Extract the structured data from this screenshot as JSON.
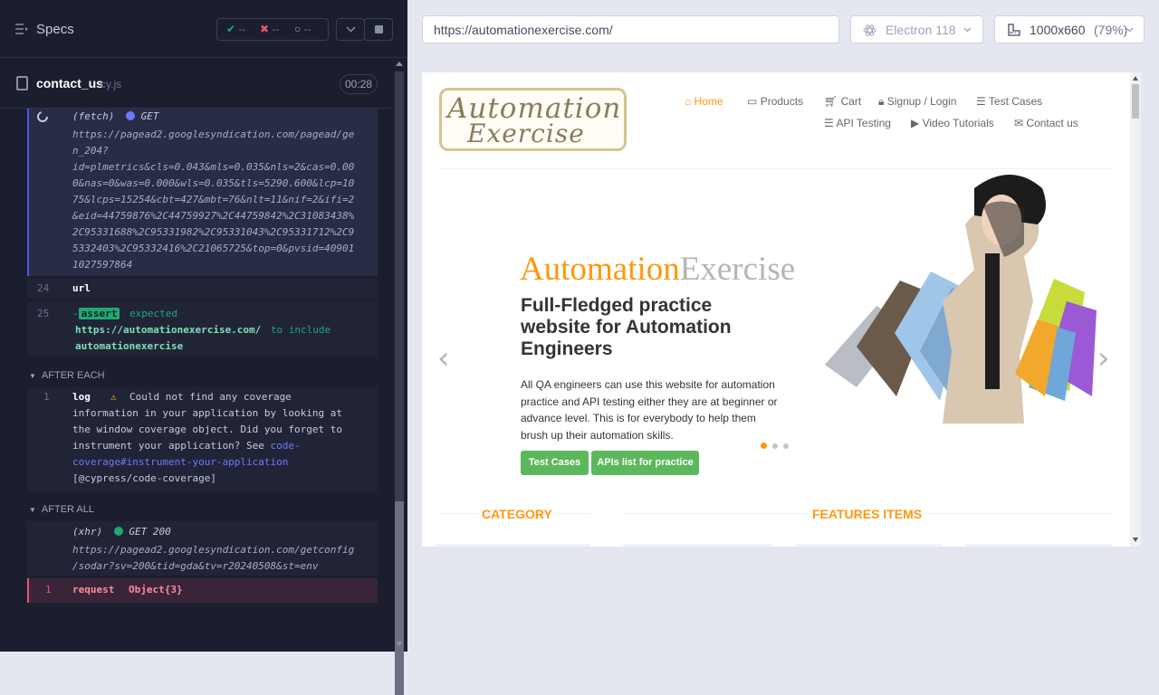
{
  "header": {
    "specs_label": "Specs",
    "pass_count": "--",
    "fail_count": "--",
    "pending_count": "--",
    "spec_file": "contact_us",
    "spec_ext": "cy.js",
    "duration": "00:28"
  },
  "log": {
    "fetch_type": "(fetch)",
    "fetch_method": "GET",
    "fetch_url_lines": [
      "https://pagead2.googlesyndication.com/pagead/ge",
      "n_204?",
      "id=plmetrics&cls=0.043&mls=0.035&nls=2&cas=0.00",
      "0&nas=0&was=0.000&wls=0.035&tls=5290.600&lcp=10",
      "75&lcps=15254&cbt=427&mbt=76&nlt=11&nif=2&ifi=2",
      "&eid=44759876%2C44759927%2C44759842%2C31083438%",
      "2C95331688%2C95331982%2C95331043%2C95331712%2C9",
      "5332403%2C95332416%2C21065725&top=0&pvsid=40901",
      "1027597864"
    ],
    "cmd24_num": "24",
    "cmd24_name": "url",
    "cmd25_num": "25",
    "cmd25_dash": "-",
    "cmd25_badge": "assert",
    "cmd25_expected": "expected",
    "cmd25_value": "https://automationexercise.com/",
    "cmd25_include": "to include",
    "cmd25_target": "automationexercise",
    "after_each_label": "AFTER EACH",
    "ae_num": "1",
    "ae_cmd": "log",
    "ae_msg_lines": [
      "Could not find any coverage",
      "information in your application by looking at",
      "the window coverage object. Did you forget to",
      "instrument your application? See"
    ],
    "ae_link_a": "code-",
    "ae_link_b": "coverage#instrument-your-application",
    "ae_tail": "[@cypress/code-coverage]",
    "after_all_label": "AFTER ALL",
    "xhr_type": "(xhr)",
    "xhr_status": "GET 200",
    "xhr_url_lines": [
      "https://pagead2.googlesyndication.com/getconfig",
      "/sodar?sv=200&tid=gda&tv=r20240508&st=env"
    ],
    "err_num": "1",
    "err_cmd": "request",
    "err_val": "Object{3}"
  },
  "browser": {
    "url": "https://automationexercise.com/",
    "engine": "Electron 118",
    "viewport": "1000x660",
    "zoom": "(79%)"
  },
  "site": {
    "logo_line1": "Automation",
    "logo_line2": "Exercise",
    "nav": {
      "home": "Home",
      "products": "Products",
      "cart": "Cart",
      "signup": "Signup / Login",
      "test_cases": "Test Cases",
      "api_testing": "API Testing",
      "video": "Video Tutorials",
      "contact": "Contact us"
    },
    "hero_brand_a": "Automation",
    "hero_brand_b": "Exercise",
    "hero_title_lines": [
      "Full-Fledged practice",
      "website for Automation",
      "Engineers"
    ],
    "hero_text_lines": [
      "All QA engineers can use this website for automation",
      "practice and API testing either they are at beginner or",
      "advance level. This is for everybody to help them",
      "brush up their automation skills."
    ],
    "btn_test_cases": "Test Cases",
    "btn_apis": "APIs list for practice",
    "category": "CATEGORY",
    "features": "FEATURES ITEMS"
  },
  "colors": {
    "orange": "#fe980f",
    "green": "#5cb85c",
    "passed": "#1fa971",
    "failed": "#e45770",
    "link": "#7178ff",
    "panel": "#1b1e2e"
  }
}
